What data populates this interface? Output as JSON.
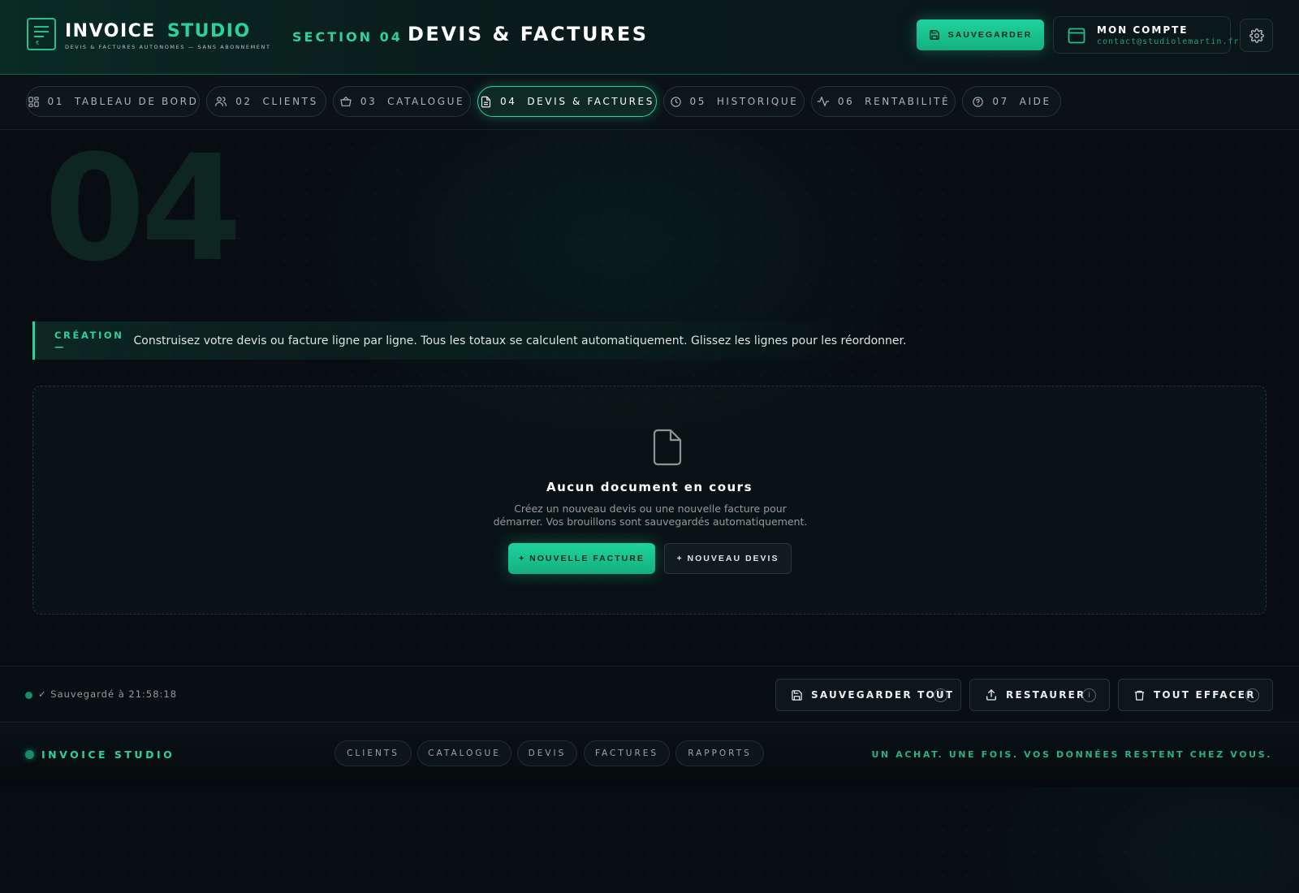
{
  "header": {
    "brand_primary": "INVOICE",
    "brand_secondary": "STUDIO",
    "brand_subtitle": "DEVIS & FACTURES AUTONOMES — SANS ABONNEMENT",
    "logo_glyph": "€",
    "section_kicker": "SECTION 04",
    "section_title": "DEVIS & FACTURES",
    "save_label": "SAUVEGARDER",
    "account_name": "MON COMPTE",
    "account_email": "contact@studiolemartin.fr"
  },
  "nav": {
    "tabs": [
      {
        "label": "01  TABLEAU DE BORD",
        "icon": "grid-icon"
      },
      {
        "label": "02  CLIENTS",
        "icon": "users-icon"
      },
      {
        "label": "03  CATALOGUE",
        "icon": "basket-icon"
      },
      {
        "label": "04  DEVIS & FACTURES",
        "icon": "document-icon",
        "active": true
      },
      {
        "label": "05  HISTORIQUE",
        "icon": "clock-icon"
      },
      {
        "label": "06  RENTABILITÉ",
        "icon": "activity-icon"
      },
      {
        "label": "07  AIDE",
        "icon": "help-icon"
      }
    ]
  },
  "hero": {
    "big_number": "04"
  },
  "notice": {
    "kicker": "CRÉATION —",
    "text": "Construisez votre devis ou facture ligne par ligne. Tous les totaux se calculent automatiquement. Glissez les lignes pour les réordonner."
  },
  "empty_state": {
    "title": "Aucun document en cours",
    "description": "Créez un nouveau devis ou une nouvelle facture pour démarrer. Vos brouillons sont sauvegardés automatiquement.",
    "new_invoice_label": "+ NOUVELLE FACTURE",
    "new_quote_label": "+ NOUVEAU DEVIS"
  },
  "savebar": {
    "status": "✓ Sauvegardé à 21:58:18",
    "save_all_label": "SAUVEGARDER TOUT",
    "restore_label": "RESTAURER",
    "clear_all_label": "TOUT EFFACER",
    "info_glyph": "i"
  },
  "footer": {
    "brand": "INVOICE STUDIO",
    "links": [
      "CLIENTS",
      "CATALOGUE",
      "DEVIS",
      "FACTURES",
      "RAPPORTS"
    ],
    "tagline": "UN ACHAT. UNE FOIS. VOS DONNÉES RESTENT CHEZ VOUS."
  },
  "colors": {
    "accent": "#2bd39b",
    "accent_button": "#1fd39c",
    "background": "#070d11",
    "surface": "#0d171b",
    "border": "#26343a"
  }
}
